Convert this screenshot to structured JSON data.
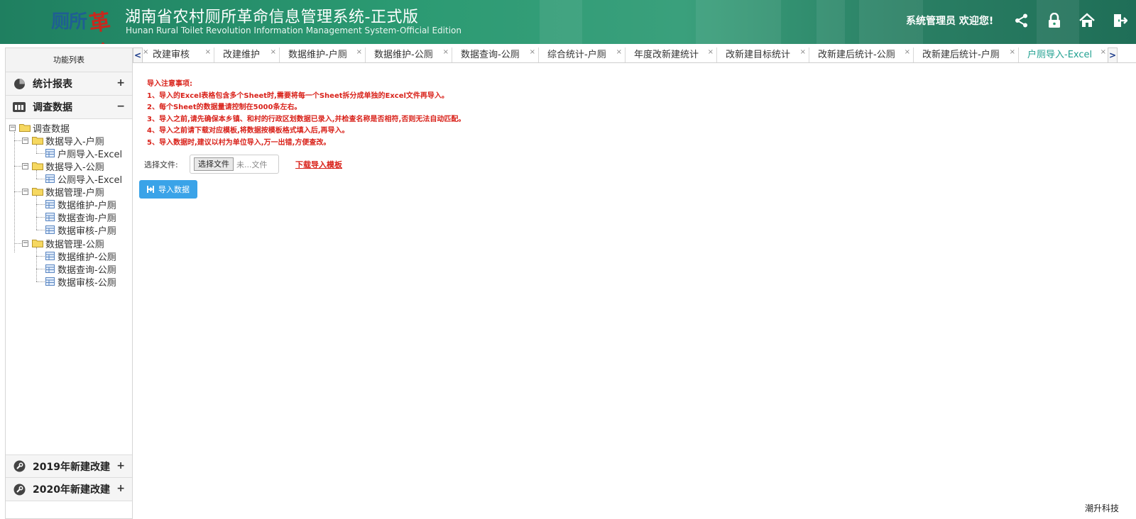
{
  "header": {
    "logo_text": "厕所革命",
    "logo_part1": "厕所",
    "logo_part2": "革命",
    "title": "湖南省农村厕所革命信息管理系统-正式版",
    "subtitle": "Hunan Rural Toilet Revolution Information Management System-Official Edition",
    "welcome": "系统管理员 欢迎您!",
    "icons": [
      "share-icon",
      "lock-icon",
      "home-icon",
      "logout-icon"
    ],
    "colors": {
      "bar": "#2b9a72",
      "logo_blue": "#1f5f92",
      "logo_red": "#c7281d"
    }
  },
  "sidebar": {
    "title": "功能列表",
    "sections": [
      {
        "label": "统计报表",
        "icon": "pie-chart-icon",
        "toggle": "+"
      },
      {
        "label": "调查数据",
        "icon": "table-icon",
        "toggle": "−"
      }
    ],
    "tree": {
      "root": "调查数据",
      "groups": [
        {
          "label": "数据导入-户厕",
          "items": [
            "户厕导入-Excel"
          ]
        },
        {
          "label": "数据导入-公厕",
          "items": [
            "公厕导入-Excel"
          ]
        },
        {
          "label": "数据管理-户厕",
          "items": [
            "数据维护-户厕",
            "数据查询-户厕",
            "数据审核-户厕"
          ]
        },
        {
          "label": "数据管理-公厕",
          "items": [
            "数据维护-公厕",
            "数据查询-公厕",
            "数据审核-公厕"
          ]
        }
      ],
      "selected": "户厕导入-Excel"
    },
    "bottom_sections": [
      {
        "label": "2019年新建改建",
        "icon": "wrench-icon",
        "toggle": "+"
      },
      {
        "label": "2020年新建改建",
        "icon": "wrench-icon",
        "toggle": "+"
      }
    ]
  },
  "tabs": {
    "prev": "<",
    "next": ">",
    "close": "×",
    "items": [
      "改建审核",
      "改建维护",
      "数据维护-户厕",
      "数据维护-公厕",
      "数据查询-公厕",
      "综合统计-户厕",
      "年度改新建统计",
      "改新建目标统计",
      "改新建后统计-公厕",
      "改新建后统计-户厕",
      "户厕导入-Excel"
    ],
    "active": "户厕导入-Excel"
  },
  "main": {
    "notice_title": "导入注意事项:",
    "notices": [
      "1、导入的Excel表格包含多个Sheet时,需要将每一个Sheet拆分成单独的Excel文件再导入。",
      "2、每个Sheet的数据量请控制在5000条左右。",
      "3、导入之前,请先确保本乡镇、和村的行政区划数据已录入,并检查名称是否相符,否则无法自动匹配。",
      "4、导入之前请下载对应模板,将数据按模板格式填入后,再导入。",
      "5、导入数据时,建议以村为单位导入,万一出错,方便查改。"
    ],
    "file_label": "选择文件:",
    "file_button": "选择文件",
    "file_none": "未...文件",
    "template_link": "下载导入模板",
    "import_button": "导入数据",
    "notice_color": "#d9221a",
    "button_color": "#3aa3e8"
  },
  "footer": {
    "brand": "潮升科技"
  }
}
